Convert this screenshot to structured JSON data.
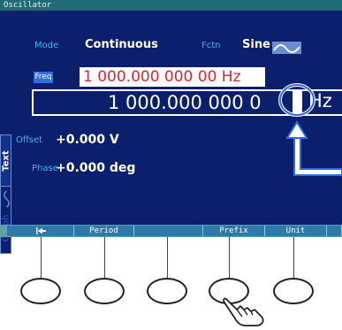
{
  "window": {
    "title": "Oscillator"
  },
  "params": {
    "mode_label": "Mode",
    "mode_value": "Continuous",
    "fctn_label": "Fctn",
    "fctn_value": "Sine",
    "freq_label": "Freq",
    "freq_value": "1 000.000 000 00 Hz",
    "freq_entry": "1 000.000 000 0",
    "cursor_digit": "0",
    "entry_unit": "Hz",
    "offset_label": "Offset",
    "offset_value": "+0.000 V",
    "phase_label": "Phase",
    "phase_value": "+0.000 deg"
  },
  "side_tabs": {
    "text": "Text",
    "graph": "Graph"
  },
  "softkeys": {
    "back_icon": "left-arrow-bar-icon",
    "period": "Period",
    "prefix": "Prefix",
    "unit": "Unit"
  },
  "icons": {
    "function_icon": "sine-wave-icon",
    "press_hint_icon": "pointing-hand-icon"
  },
  "colors": {
    "screen_bg": "#0b1f6d",
    "label": "#48b5e3",
    "accent_red": "#e0252a",
    "softkey": "#2f79a8"
  }
}
